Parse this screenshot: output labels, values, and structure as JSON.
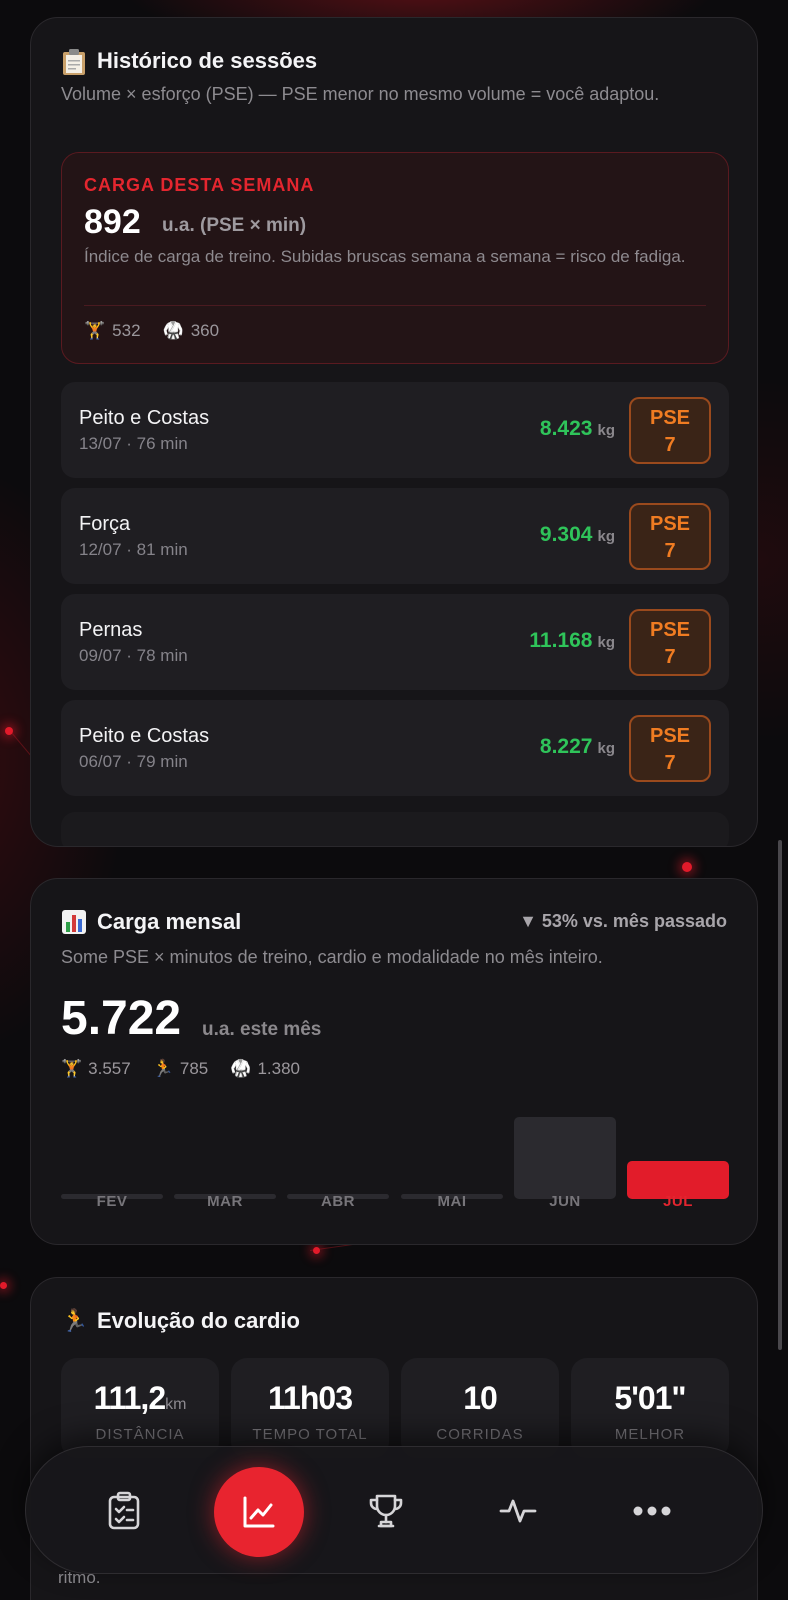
{
  "history": {
    "icon": "clipboard-icon",
    "title": "Histórico de sessões",
    "subtitle": "Volume × esforço (PSE) — PSE menor no mesmo volume = você adaptou.",
    "week": {
      "eyebrow": "CARGA DESTA SEMANA",
      "value": "892",
      "unit": "u.a. (PSE × min)",
      "description": "Índice de carga de treino. Subidas bruscas semana a semana = risco de fadiga.",
      "strength": "532",
      "modality": "360"
    },
    "sessions": [
      {
        "name": "Peito e Costas",
        "meta": "13/07 · 76 min",
        "volume": "8.423",
        "unit": "kg",
        "pse_label": "PSE",
        "pse": "7"
      },
      {
        "name": "Força",
        "meta": "12/07 · 81 min",
        "volume": "9.304",
        "unit": "kg",
        "pse_label": "PSE",
        "pse": "7"
      },
      {
        "name": "Pernas",
        "meta": "09/07 · 78 min",
        "volume": "11.168",
        "unit": "kg",
        "pse_label": "PSE",
        "pse": "7"
      },
      {
        "name": "Peito e Costas",
        "meta": "06/07 · 79 min",
        "volume": "8.227",
        "unit": "kg",
        "pse_label": "PSE",
        "pse": "7"
      }
    ]
  },
  "monthly": {
    "icon": "bar-chart-icon",
    "title": "Carga mensal",
    "delta": "▼ 53% vs. mês passado",
    "subtitle": "Some PSE × minutos de treino, cardio e modalidade no mês inteiro.",
    "value": "5.722",
    "unit": "u.a. este mês",
    "strength": "3.557",
    "cardio": "785",
    "modality": "1.380"
  },
  "chart_data": {
    "type": "bar",
    "categories": [
      "FEV",
      "MAR",
      "ABR",
      "MAI",
      "JUN",
      "JUL"
    ],
    "values": [
      0,
      0,
      0,
      0,
      12200,
      5722
    ],
    "current_index": 5,
    "colors": {
      "default": "#2b2a2f",
      "current": "#e21c2a"
    }
  },
  "cardio": {
    "icon": "runner-icon",
    "title": "Evolução do cardio",
    "stats": [
      {
        "value": "111,2",
        "unit": "km",
        "label": "DISTÂNCIA"
      },
      {
        "value": "11h03",
        "unit": "",
        "label": "TEMPO TOTAL"
      },
      {
        "value": "10",
        "unit": "",
        "label": "CORRIDAS"
      },
      {
        "value": "5'01\"",
        "unit": "",
        "label": "MELHOR"
      }
    ],
    "peek_text": "ritmo."
  },
  "nav": {
    "items": [
      "clipboard-icon",
      "trend-chart-icon",
      "trophy-icon",
      "activity-icon",
      "more-icon"
    ],
    "active": "trend-chart-icon"
  },
  "colors": {
    "accent": "#e8242f",
    "positive": "#2fc45a",
    "pse": "#f07c22"
  }
}
